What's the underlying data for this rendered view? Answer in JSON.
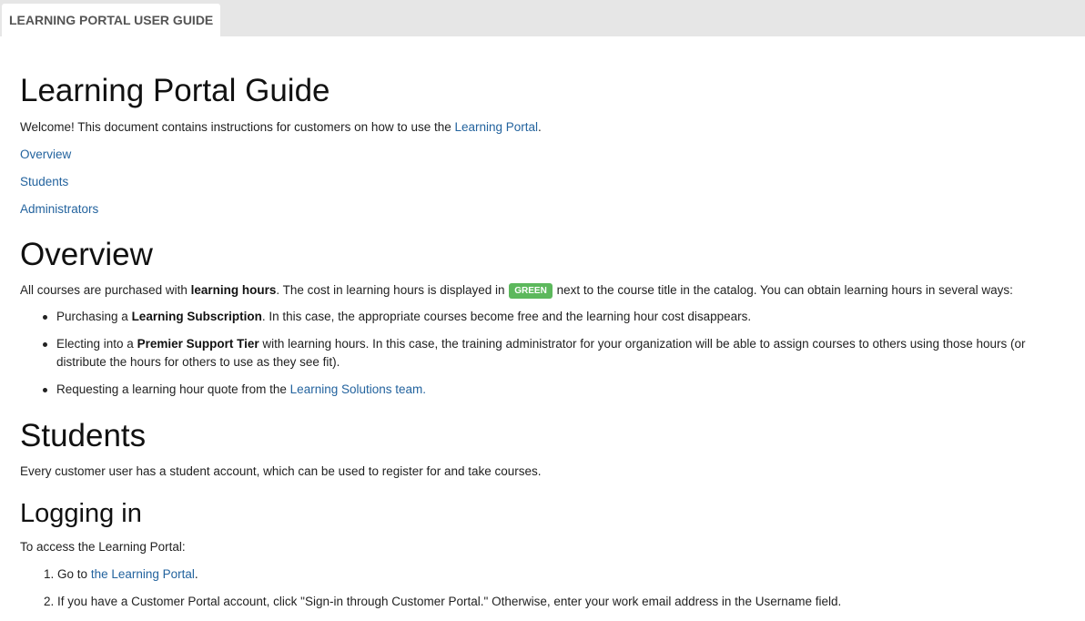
{
  "tab": {
    "label": "LEARNING PORTAL USER GUIDE"
  },
  "title": "Learning Portal Guide",
  "intro": {
    "before": "Welcome! This document contains instructions for customers on how to use the ",
    "link": "Learning Portal",
    "after": "."
  },
  "toc": [
    "Overview",
    "Students",
    "Administrators"
  ],
  "overview": {
    "heading": "Overview",
    "p_before": "All courses are purchased with ",
    "p_bold": "learning hours",
    "p_mid": ". The cost in learning hours is displayed in ",
    "badge": "GREEN",
    "p_after": " next to the course title in the catalog. You can obtain learning hours in several ways:",
    "bullets": [
      {
        "before": "Purchasing a ",
        "bold": "Learning Subscription",
        "after": ". In this case, the appropriate courses become free and the learning hour cost disappears."
      },
      {
        "before": "Electing into a ",
        "bold": "Premier Support Tier",
        "after": " with learning hours. In this case, the training administrator for your organization will be able to assign courses to others using those hours (or distribute the hours for others to use as they see fit)."
      },
      {
        "before": "Requesting a learning hour quote from the ",
        "link": "Learning Solutions team.",
        "after": ""
      }
    ]
  },
  "students": {
    "heading": "Students",
    "p": "Every customer user has a student account, which can be used to register for and take courses."
  },
  "logging_in": {
    "heading": "Logging in",
    "p": "To access the Learning Portal:",
    "steps": [
      {
        "num": "1.",
        "before": "Go to ",
        "link": "the Learning Portal",
        "after": "."
      },
      {
        "num": "2.",
        "text": "If you have a Customer Portal account, click \"Sign-in through Customer Portal.\" Otherwise, enter your work email address in the Username field."
      }
    ]
  }
}
